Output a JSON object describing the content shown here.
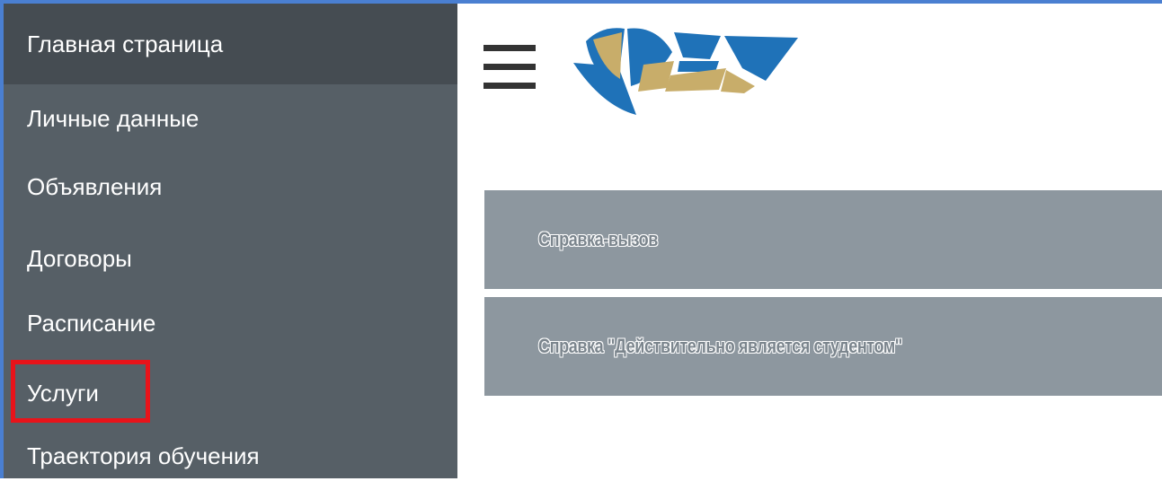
{
  "sidebar": {
    "items": [
      {
        "label": "Главная страница"
      },
      {
        "label": "Личные данные"
      },
      {
        "label": "Объявления"
      },
      {
        "label": "Договоры"
      },
      {
        "label": "Расписание"
      },
      {
        "label": "Услуги"
      },
      {
        "label": "Траектория обучения"
      }
    ]
  },
  "header": {
    "menu_icon": "hamburger-icon",
    "logo": "university-logo"
  },
  "services": [
    {
      "label": "Справка-вызов"
    },
    {
      "label": "Справка \"Действительно является студентом\""
    }
  ],
  "colors": {
    "sidebar_bg": "#565f66",
    "sidebar_active_bg": "#454c52",
    "service_bg": "#8d979f",
    "highlight": "#e8131a",
    "frame_border": "#4a7fd1",
    "logo_blue": "#1f72b8",
    "logo_gold": "#c8ad6a"
  }
}
